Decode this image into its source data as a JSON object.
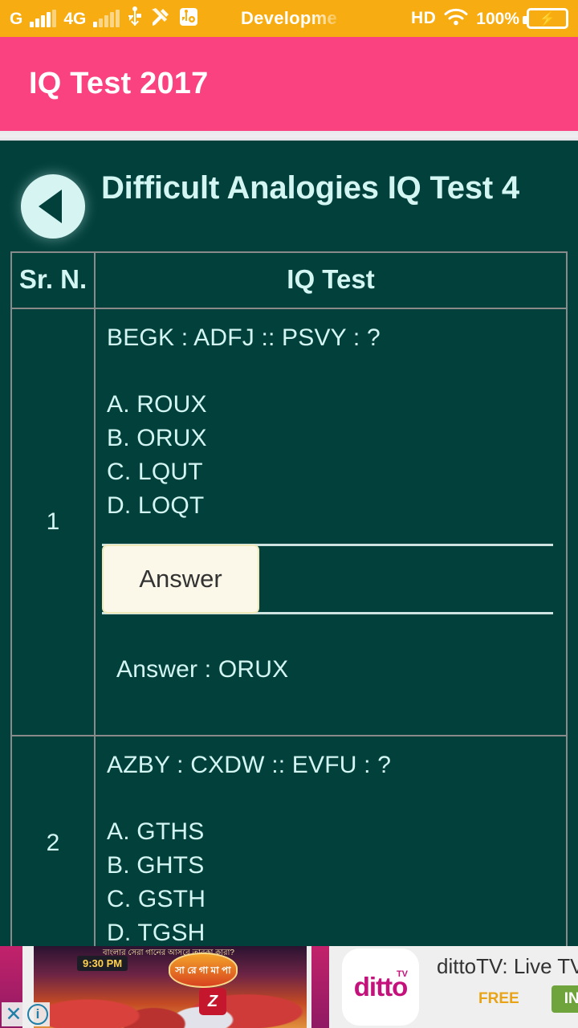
{
  "status_bar": {
    "network_label_1": "G",
    "network_label_2": "4G",
    "carrier_title": "Developme",
    "hd_label": "HD",
    "battery_percent": "100%",
    "icons": [
      "signal-bars-icon",
      "usb-icon",
      "developer-tools-icon",
      "usb-debugging-icon",
      "wifi-icon",
      "battery-charging-icon"
    ],
    "background_color": "#f7ad12"
  },
  "app_bar": {
    "title": "IQ Test 2017",
    "background_color": "#fb4280"
  },
  "page": {
    "back_button_label": "Back",
    "title": "Difficult Analogies IQ Test 4",
    "background_color": "#02403c",
    "text_color": "#d4f6f3",
    "border_color": "#8a8a8a"
  },
  "table": {
    "headers": [
      "Sr. N.",
      "IQ Test"
    ],
    "rows": [
      {
        "sr_no": "1",
        "stem": "BEGK : ADFJ :: PSVY : ?",
        "options": [
          "A. ROUX",
          "B. ORUX",
          "C. LQUT",
          "D. LOQT"
        ],
        "answer_tab_label": "Answer",
        "answer_text": "Answer : ORUX"
      },
      {
        "sr_no": "2",
        "stem": "AZBY : CXDW :: EVFU : ?",
        "options": [
          "A. GTHS",
          "B. GHTS",
          "C. GSTH",
          "D. TGSH"
        ]
      }
    ]
  },
  "ad": {
    "app_name": "dittoTV: Live TV Shows ...",
    "price_label": "FREE",
    "install_label": "INSTALL",
    "brand_text": "ditto",
    "brand_superscript": "TV",
    "creative_time_badge": "9:30 PM",
    "creative_logo_text": "সা রে গা মা পা",
    "creative_caption": "ব‍াংলার সেরা গানের আসরে তারকা কারা?",
    "creative_channel": "Z",
    "close_label": "✕",
    "info_label": "i",
    "install_color": "#6fa33c",
    "price_color": "#e8a317"
  }
}
